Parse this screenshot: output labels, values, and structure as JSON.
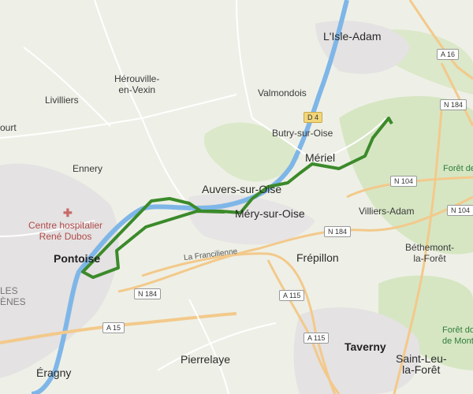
{
  "map": {
    "colors": {
      "background": "#eef0e7",
      "forest": "#d6e6c3",
      "urban": "#e4e2e2",
      "water": "#7fb6e8",
      "route": "#3b8a2a",
      "major_road": "#f3c98b",
      "minor_road": "#ffffff"
    },
    "places": {
      "lisle_adam": "L'Isle-Adam",
      "valmondois": "Valmondois",
      "herouville": "Hérouville-\nen-Vexin",
      "livilliers": "Livilliers",
      "ennery": "Ennery",
      "butry": "Butry-sur-Oise",
      "meriel": "Mériel",
      "auvers": "Auvers-sur-Oise",
      "mery": "Méry-sur-Oise",
      "villiers_adam": "Villiers-Adam",
      "bethemont": "Béthemont-\nla-Forêt",
      "frepillon": "Frépillon",
      "pontoise": "Pontoise",
      "taverny": "Taverny",
      "saint_leu": "Saint-Leu-\nla-Forêt",
      "pierrelaye": "Pierrelaye",
      "eragny": "Éragny",
      "ourt": "ourt",
      "les_enes": "LES\nÈNES"
    },
    "forests": {
      "foret_right": "Forêt de",
      "foret_montmorency": "Forêt do\nde Mont"
    },
    "poi": {
      "hospital": "Centre hospitalier\nRené Dubos"
    },
    "roads": {
      "la_francilienne": "La Francilienne",
      "a16": "A 16",
      "n184_top": "N 184",
      "d4": "D 4",
      "n104_mid": "N 104",
      "n104_right": "N 104",
      "n184_mid": "N 184",
      "n184_left": "N 184",
      "a115_mid": "A 115",
      "a115_low": "A 115",
      "a15": "A 15"
    }
  }
}
